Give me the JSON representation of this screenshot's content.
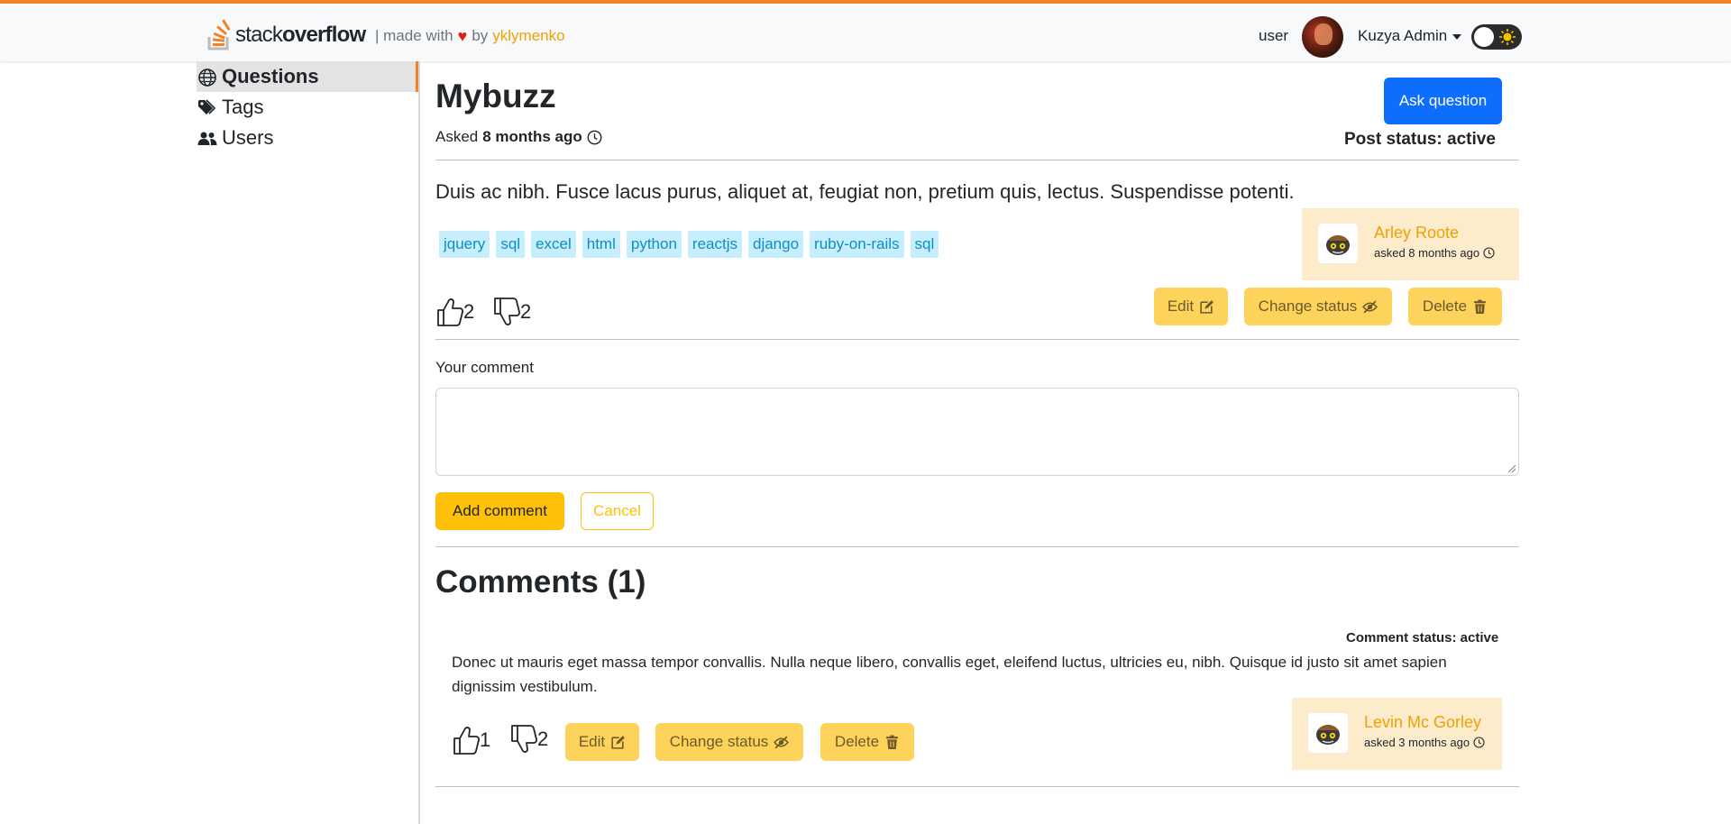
{
  "header": {
    "logo_light": "stack",
    "logo_bold": "overflow",
    "made_with": "| made with",
    "by": "by",
    "author": "yklymenko",
    "user_label": "user",
    "account_name": "Kuzya Admin"
  },
  "sidebar": {
    "items": [
      {
        "label": "Questions",
        "icon": "globe-icon"
      },
      {
        "label": "Tags",
        "icon": "tags-icon"
      },
      {
        "label": "Users",
        "icon": "users-icon"
      }
    ]
  },
  "question": {
    "title": "Mybuzz",
    "asked_prefix": "Asked",
    "asked_time": "8 months ago",
    "ask_button": "Ask question",
    "post_status": "Post status: active",
    "body": "Duis ac nibh. Fusce lacus purus, aliquet at, feugiat non, pretium quis, lectus. Suspendisse potenti.",
    "tags": [
      "jquery",
      "sql",
      "excel",
      "html",
      "python",
      "reactjs",
      "django",
      "ruby-on-rails",
      "sql"
    ],
    "author_name": "Arley Roote",
    "author_asked": "asked 8 months ago",
    "likes": "2",
    "dislikes": "2",
    "edit": "Edit",
    "change_status": "Change status",
    "delete": "Delete"
  },
  "comment_form": {
    "label": "Your comment",
    "value": "",
    "add": "Add comment",
    "cancel": "Cancel"
  },
  "comments": {
    "title": "Comments (1)",
    "items": [
      {
        "status": "Comment status: active",
        "body": "Donec ut mauris eget massa tempor convallis. Nulla neque libero, convallis eget, eleifend luctus, ultricies eu, nibh. Quisque id justo sit amet sapien dignissim vestibulum.",
        "likes": "1",
        "dislikes": "2",
        "edit": "Edit",
        "change_status": "Change status",
        "delete": "Delete",
        "author_name": "Levin Mc Gorley",
        "author_asked": "asked 3 months ago"
      }
    ]
  },
  "colors": {
    "accent": "#f48225",
    "primary": "#0d6efd",
    "warning": "#ffc107",
    "author_bg": "#fdeccb",
    "tag_bg": "#c7eefd"
  }
}
